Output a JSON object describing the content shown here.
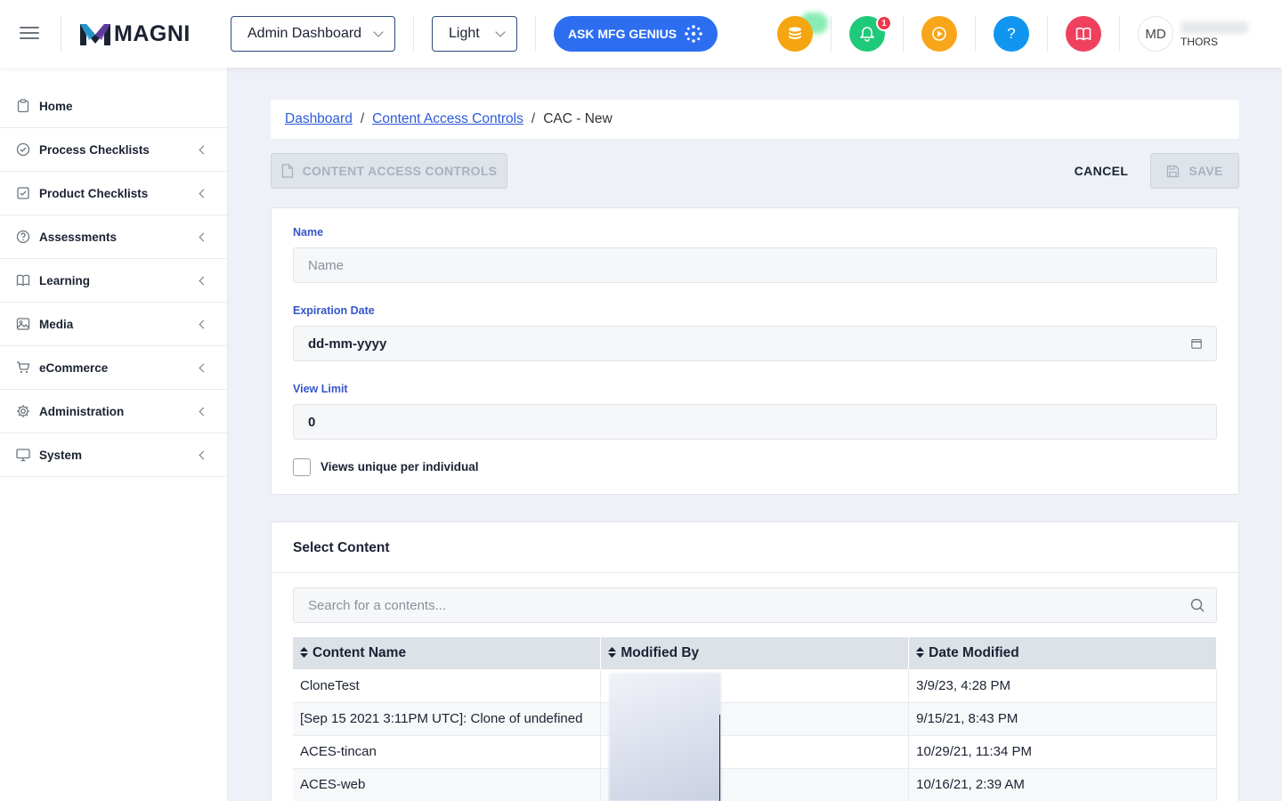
{
  "header": {
    "logo_text": "MAGNI",
    "dashboard_select": "Admin Dashboard",
    "theme_select": "Light",
    "ask_button": "ASK MFG GENIUS",
    "notification_count": "1",
    "avatar_initials": "MD",
    "user_org": "THORS"
  },
  "sidebar": {
    "items": [
      {
        "label": "Home",
        "icon": "clipboard-icon"
      },
      {
        "label": "Process Checklists",
        "icon": "check-circle-icon"
      },
      {
        "label": "Product Checklists",
        "icon": "check-square-icon"
      },
      {
        "label": "Assessments",
        "icon": "question-circle-icon"
      },
      {
        "label": "Learning",
        "icon": "book-open-icon"
      },
      {
        "label": "Media",
        "icon": "image-icon"
      },
      {
        "label": "eCommerce",
        "icon": "cart-icon"
      },
      {
        "label": "Administration",
        "icon": "gear-icon"
      },
      {
        "label": "System",
        "icon": "monitor-icon"
      }
    ]
  },
  "breadcrumb": {
    "dashboard": "Dashboard",
    "content_access_controls": "Content Access Controls",
    "current": "CAC - New"
  },
  "actions": {
    "cac_button": "CONTENT ACCESS CONTROLS",
    "cancel": "CANCEL",
    "save": "SAVE"
  },
  "form": {
    "name_label": "Name",
    "name_placeholder": "Name",
    "expiration_label": "Expiration Date",
    "expiration_value": "dd-mm-yyyy",
    "view_limit_label": "View Limit",
    "view_limit_value": "0",
    "unique_label": "Views unique per individual"
  },
  "content": {
    "title": "Select Content",
    "search_placeholder": "Search for a contents...",
    "columns": [
      "Content Name",
      "Modified By",
      "Date Modified"
    ],
    "rows": [
      {
        "name": "CloneTest",
        "modified_by": "",
        "date": "3/9/23, 4:28 PM"
      },
      {
        "name": "[Sep 15 2021 3:11PM UTC]: Clone of undefined",
        "modified_by": "",
        "date": "9/15/21, 8:43 PM"
      },
      {
        "name": "ACES-tincan",
        "modified_by": "",
        "date": "10/29/21, 11:34 PM"
      },
      {
        "name": "ACES-web",
        "modified_by": "",
        "date": "10/16/21, 2:39 AM"
      }
    ]
  },
  "colors": {
    "primary": "#2d6ef0",
    "label_blue": "#3556c9",
    "coin_orange": "#f5a50f",
    "bell_green": "#1fc97a",
    "play_orange": "#f9a51a",
    "help_blue": "#1196f0",
    "book_pink": "#f0405e"
  }
}
